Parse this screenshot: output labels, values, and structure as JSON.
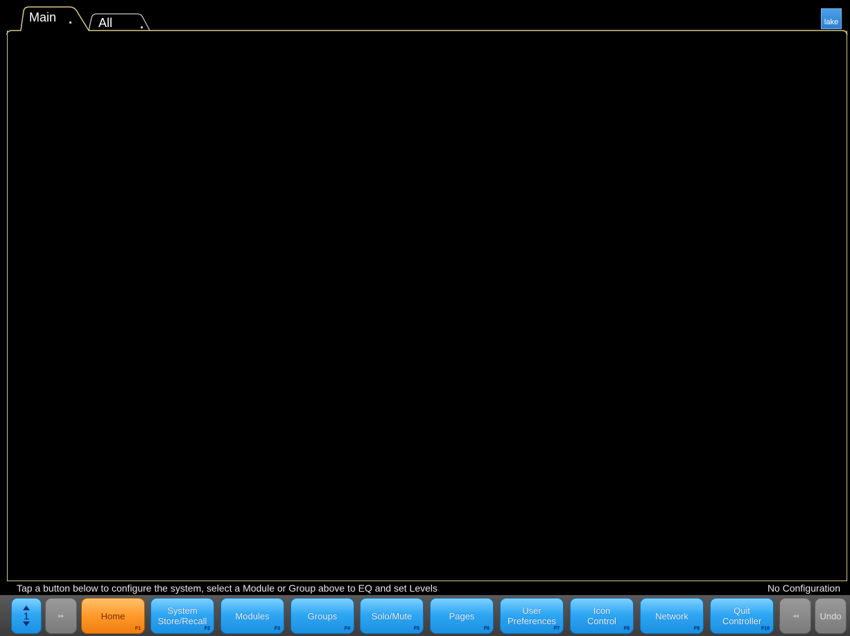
{
  "tabs": [
    {
      "label": "Main",
      "active": true
    },
    {
      "label": "All",
      "active": false
    }
  ],
  "logo": {
    "text": "lake"
  },
  "status": {
    "hint": "Tap a button below to configure the system, select a Module or Group above to EQ and set Levels",
    "configuration": "No Configuration"
  },
  "toolbar": {
    "page_number": "1",
    "page_up_icon": "arrow-up-icon",
    "page_down_icon": "arrow-down-icon",
    "forward_label": "▸▸",
    "buttons": [
      {
        "line1": "Home",
        "line2": "",
        "fkey": "F1"
      },
      {
        "line1": "System",
        "line2": "Store/Recall",
        "fkey": "F2"
      },
      {
        "line1": "Modules",
        "line2": "",
        "fkey": "F3"
      },
      {
        "line1": "Groups",
        "line2": "",
        "fkey": "F4"
      },
      {
        "line1": "Solo/Mute",
        "line2": "",
        "fkey": "F5"
      },
      {
        "line1": "Pages",
        "line2": "",
        "fkey": "F6"
      },
      {
        "line1": "User",
        "line2": "Preferences",
        "fkey": "F7"
      },
      {
        "line1": "Icon",
        "line2": "Control",
        "fkey": "F8"
      },
      {
        "line1": "Network",
        "line2": "",
        "fkey": "F9"
      },
      {
        "line1": "Quit",
        "line2": "Controller",
        "fkey": "F10"
      }
    ],
    "back_label": "◂◂",
    "undo_label": "Undo"
  },
  "colors": {
    "frame_line": "#d8c98a",
    "button_blue": "#2fa7f3",
    "button_active": "#ff9a2a",
    "button_disabled": "#7a7a7a"
  }
}
